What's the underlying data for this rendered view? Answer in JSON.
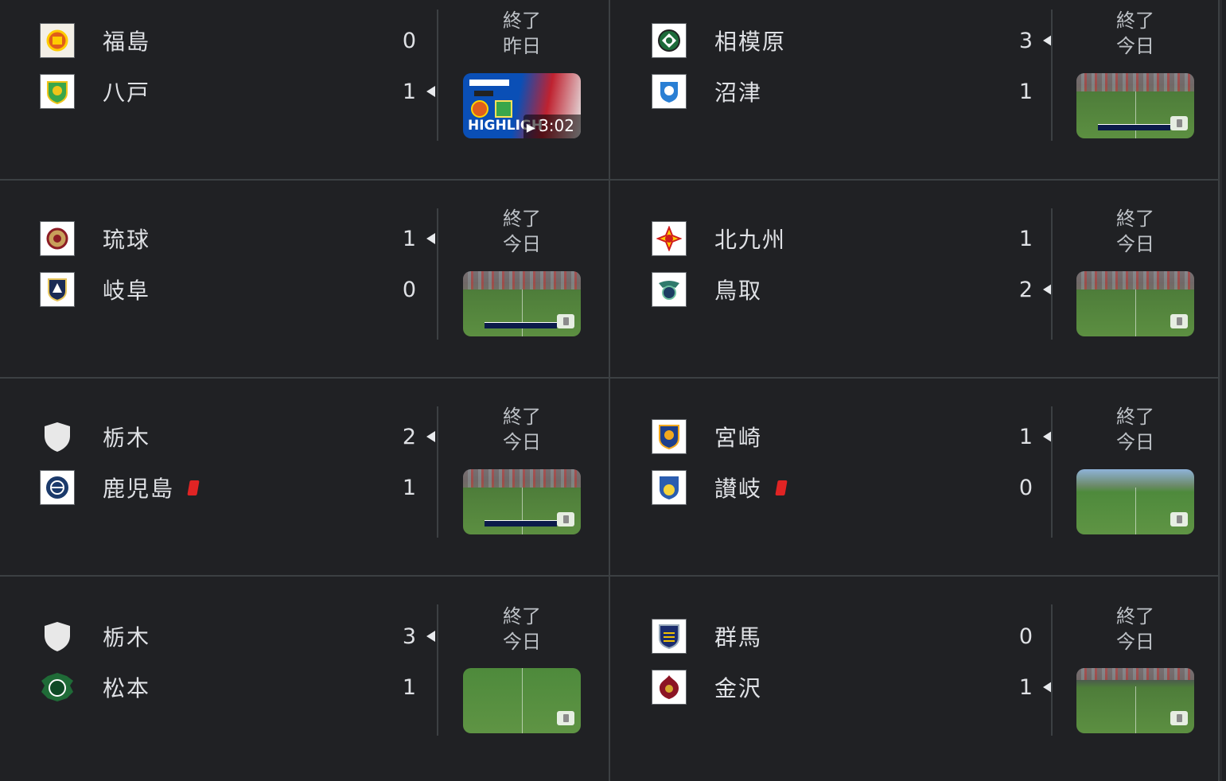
{
  "status_label": "終了",
  "matches": [
    {
      "home": {
        "name": "福島",
        "score": "0",
        "logo": "fukushima-logo",
        "winner": false,
        "red_card": false
      },
      "away": {
        "name": "八戸",
        "score": "1",
        "logo": "hachinohe-logo",
        "winner": true,
        "red_card": false
      },
      "status": "終了",
      "day": "昨日",
      "thumbnail": {
        "type": "highlight",
        "label": "HIGHLIGH",
        "duration": "3:02"
      }
    },
    {
      "home": {
        "name": "相模原",
        "score": "3",
        "logo": "sagamihara-logo",
        "winner": true,
        "red_card": false
      },
      "away": {
        "name": "沼津",
        "score": "1",
        "logo": "numazu-logo",
        "winner": false,
        "red_card": false
      },
      "status": "終了",
      "day": "今日",
      "thumbnail": {
        "type": "video"
      }
    },
    {
      "home": {
        "name": "琉球",
        "score": "1",
        "logo": "ryukyu-logo",
        "winner": true,
        "red_card": false
      },
      "away": {
        "name": "岐阜",
        "score": "0",
        "logo": "gifu-logo",
        "winner": false,
        "red_card": false
      },
      "status": "終了",
      "day": "今日",
      "thumbnail": {
        "type": "video"
      }
    },
    {
      "home": {
        "name": "北九州",
        "score": "1",
        "logo": "kitakyushu-logo",
        "winner": false,
        "red_card": false
      },
      "away": {
        "name": "鳥取",
        "score": "2",
        "logo": "tottori-logo",
        "winner": true,
        "red_card": false
      },
      "status": "終了",
      "day": "今日",
      "thumbnail": {
        "type": "video"
      }
    },
    {
      "home": {
        "name": "栃木",
        "score": "2",
        "logo": "shield-icon",
        "winner": true,
        "red_card": false
      },
      "away": {
        "name": "鹿児島",
        "score": "1",
        "logo": "kagoshima-logo",
        "winner": false,
        "red_card": true
      },
      "status": "終了",
      "day": "今日",
      "thumbnail": {
        "type": "video"
      }
    },
    {
      "home": {
        "name": "宮崎",
        "score": "1",
        "logo": "miyazaki-logo",
        "winner": true,
        "red_card": false
      },
      "away": {
        "name": "讃岐",
        "score": "0",
        "logo": "sanuki-logo",
        "winner": false,
        "red_card": true
      },
      "status": "終了",
      "day": "今日",
      "thumbnail": {
        "type": "video"
      }
    },
    {
      "home": {
        "name": "栃木",
        "score": "3",
        "logo": "shield-icon",
        "winner": true,
        "red_card": false
      },
      "away": {
        "name": "松本",
        "score": "1",
        "logo": "matsumoto-logo",
        "winner": false,
        "red_card": false
      },
      "status": "終了",
      "day": "今日",
      "thumbnail": {
        "type": "video"
      }
    },
    {
      "home": {
        "name": "群馬",
        "score": "0",
        "logo": "gunma-logo",
        "winner": false,
        "red_card": false
      },
      "away": {
        "name": "金沢",
        "score": "1",
        "logo": "kanazawa-logo",
        "winner": true,
        "red_card": false
      },
      "status": "終了",
      "day": "今日",
      "thumbnail": {
        "type": "video"
      }
    }
  ],
  "colors": {
    "background": "#202124",
    "divider": "#3c4043",
    "text": "#dfe1e5",
    "red_card": "#e02424"
  }
}
